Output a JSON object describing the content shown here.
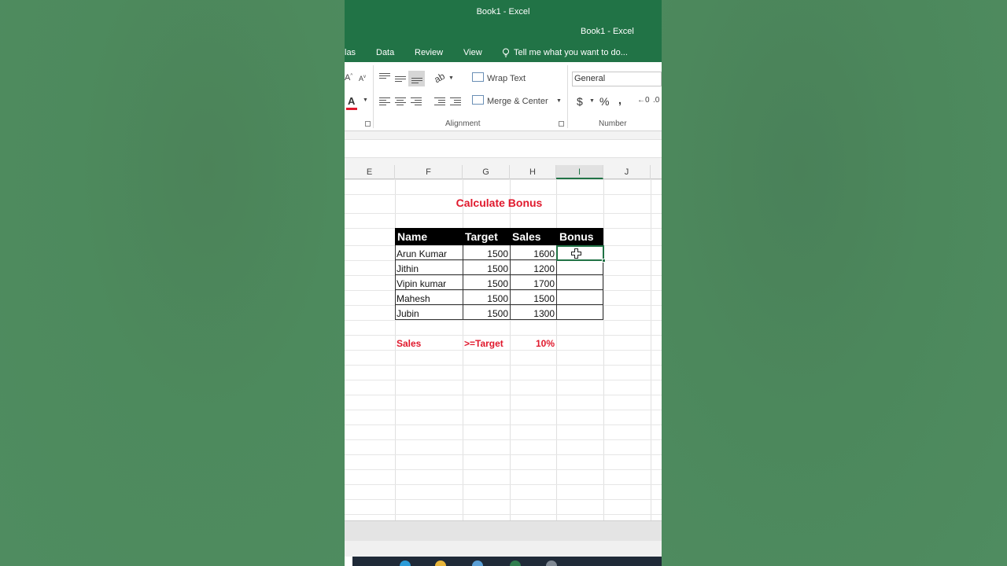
{
  "window": {
    "title_main": "Book1 - Excel",
    "title_secondary": "Book1 - Excel"
  },
  "ribbon_tabs": [
    "las",
    "Data",
    "Review",
    "View"
  ],
  "tell_me": "Tell me what you want to do...",
  "ribbon": {
    "wrap_text": "Wrap Text",
    "merge_center": "Merge & Center",
    "number_format": "General",
    "currency_symbol": "$",
    "percent_symbol": "%",
    "comma_symbol": ",",
    "alignment_label": "Alignment",
    "number_label": "Number",
    "font_color_letter": "A",
    "font_color": "#e0192d"
  },
  "columns": [
    "E",
    "F",
    "G",
    "H",
    "I",
    "J"
  ],
  "selected_column": "I",
  "sheet": {
    "title": "Calculate Bonus",
    "headers": [
      "Name",
      "Target",
      "Sales",
      "Bonus"
    ],
    "rows": [
      {
        "name": "Arun Kumar",
        "target": "1500",
        "sales": "1600",
        "bonus": ""
      },
      {
        "name": "Jithin",
        "target": "1500",
        "sales": "1200",
        "bonus": ""
      },
      {
        "name": "Vipin kumar",
        "target": "1500",
        "sales": "1700",
        "bonus": ""
      },
      {
        "name": "Mahesh",
        "target": "1500",
        "sales": "1500",
        "bonus": ""
      },
      {
        "name": "Jubin",
        "target": "1500",
        "sales": "1300",
        "bonus": ""
      }
    ],
    "condition": {
      "field": "Sales",
      "operator": ">=Target",
      "rate": "10%"
    }
  },
  "colors": {
    "excel_green": "#217346",
    "accent_red": "#e0192d",
    "background_green": "#4f8a60"
  }
}
